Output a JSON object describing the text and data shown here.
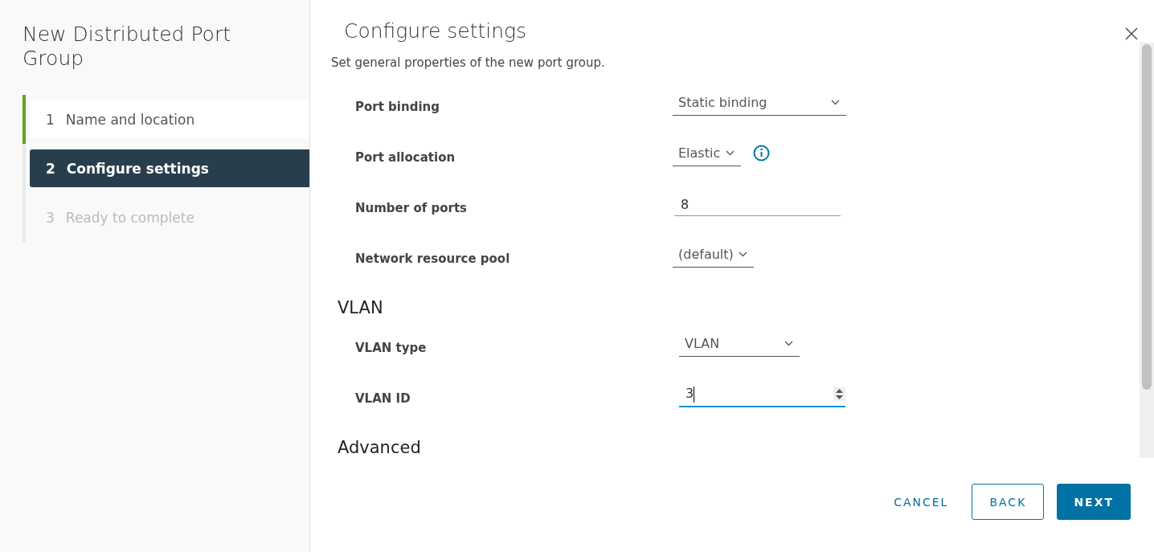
{
  "wizard": {
    "title": "New Distributed Port Group",
    "steps": [
      {
        "number": "1",
        "label": "Name and location",
        "selected": false,
        "completed": true,
        "disabled": false
      },
      {
        "number": "2",
        "label": "Configure settings",
        "selected": true,
        "completed": false,
        "disabled": false
      },
      {
        "number": "3",
        "label": "Ready to complete",
        "selected": false,
        "completed": false,
        "disabled": true
      }
    ]
  },
  "page": {
    "title": "Configure settings",
    "description": "Set general properties of the new port group.",
    "sections": [
      {
        "fields": [
          {
            "kind": "select",
            "label": "Port binding",
            "value": "Static binding"
          },
          {
            "kind": "select",
            "label": "Port allocation",
            "value": "Elastic",
            "info": true
          },
          {
            "kind": "input",
            "label": "Number of ports",
            "value": "8"
          },
          {
            "kind": "select",
            "label": "Network resource pool",
            "value": "(default)"
          }
        ]
      },
      {
        "heading": "VLAN",
        "fields": [
          {
            "kind": "select",
            "label": "VLAN type",
            "value": "VLAN"
          },
          {
            "kind": "number",
            "label": "VLAN ID",
            "value": "3",
            "focused": true
          }
        ]
      },
      {
        "heading": "Advanced"
      }
    ]
  },
  "footer": {
    "buttons": [
      {
        "kind": "flat",
        "label": "CANCEL"
      },
      {
        "kind": "outline",
        "label": "BACK"
      },
      {
        "kind": "primary",
        "label": "NEXT"
      }
    ]
  }
}
